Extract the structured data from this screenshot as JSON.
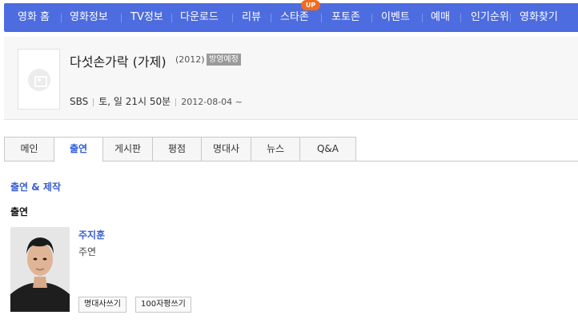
{
  "nav": {
    "items": [
      "영화 홈",
      "영화정보",
      "TV정보",
      "다운로드",
      "리뷰",
      "스타존",
      "포토존",
      "이벤트",
      "예매",
      "인기순위",
      "영화찾기"
    ],
    "badge": "UP"
  },
  "movie": {
    "title": "다섯손가락 (가제)",
    "year": "(2012)",
    "status": "방영예정",
    "channel": "SBS",
    "schedule": "토, 일 21시 50분",
    "date": "2012-08-04 ~"
  },
  "tabs": [
    "메인",
    "출연",
    "게시판",
    "평점",
    "명대사",
    "뉴스",
    "Q&A"
  ],
  "content": {
    "section_title": "출연 & 제작",
    "sub_title": "출연",
    "cast": [
      {
        "name": "주지훈",
        "role": "주연"
      }
    ],
    "buttons": [
      "명대사쓰기",
      "100자평쓰기"
    ]
  }
}
